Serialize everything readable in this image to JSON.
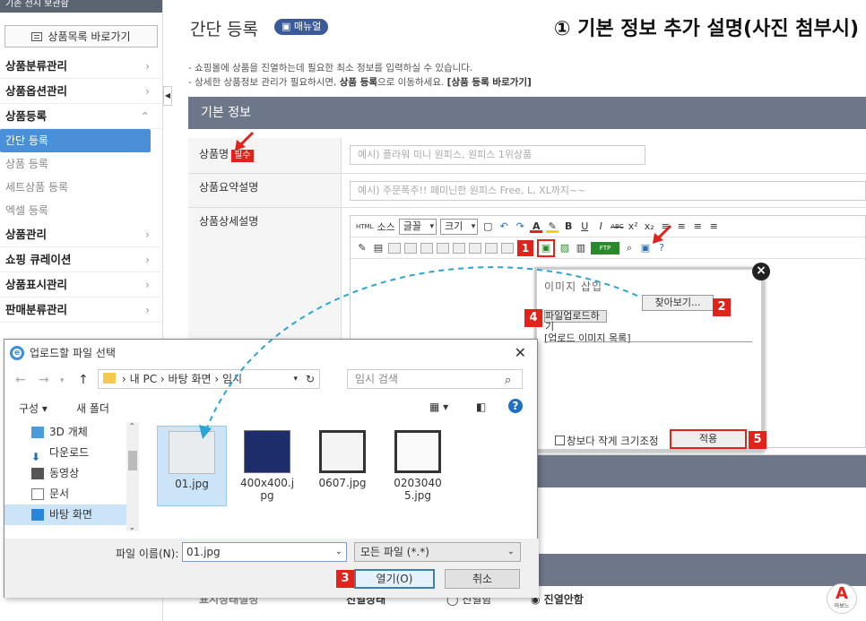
{
  "sidebar": {
    "top_text": "기존 전시 보관함",
    "shortcut_button": "상품목록 바로가기",
    "menu": [
      {
        "label": "상품분류관리",
        "type": "item"
      },
      {
        "label": "상품옵션관리",
        "type": "item"
      },
      {
        "label": "상품등록",
        "type": "item",
        "expanded": true
      },
      {
        "label": "간단 등록",
        "type": "sub",
        "active": true
      },
      {
        "label": "상품 등록",
        "type": "sub"
      },
      {
        "label": "세트상품 등록",
        "type": "sub"
      },
      {
        "label": "엑셀 등록",
        "type": "sub"
      },
      {
        "label": "상품관리",
        "type": "item"
      },
      {
        "label": "쇼핑 큐레이션",
        "type": "item"
      },
      {
        "label": "상품표시관리",
        "type": "item"
      },
      {
        "label": "판매분류관리",
        "type": "item"
      }
    ]
  },
  "header": {
    "title": "간단 등록",
    "manual_button": "매뉴얼",
    "caption": "① 기본 정보 추가 설명(사진 첨부시)"
  },
  "description": {
    "line1": "- 쇼핑몰에 상품을 진열하는데 필요한 최소 정보를 입력하실 수 있습니다.",
    "line2_a": "- 상세한 상품정보 관리가 필요하시면, ",
    "line2_b": "상품 등록",
    "line2_c": "으로 이동하세요. ",
    "line2_d": "[상품 등록 바로가기]"
  },
  "basic_info": {
    "section_title": "기본 정보",
    "product_name_label": "상품명",
    "required_badge": "필수",
    "product_name_placeholder": "예시) 플라워 미니 원피스, 원피스 1위상품",
    "summary_label": "상품요약설명",
    "summary_placeholder": "예시) 주문폭주!! 페미닌한 원피스 Free, L, XL까지~~",
    "detail_label": "상품상세설명"
  },
  "editor": {
    "source": "소스",
    "font": "글꼴",
    "size": "크기"
  },
  "image_dialog": {
    "title": "이미지 삽입",
    "browse_button": "찾아보기...",
    "upload_button": "파일업로드하기",
    "list_label": "[업로드 이미지 목록]",
    "resize_checkbox": "창보다 작게 크기조정",
    "apply_button": "적용"
  },
  "step_badges": [
    "1",
    "2",
    "3",
    "4",
    "5"
  ],
  "file_dialog": {
    "title": "업로드할 파일 선택",
    "path": [
      "내 PC",
      "바탕 화면",
      "임시"
    ],
    "search_placeholder": "임시 검색",
    "organize": "구성",
    "new_folder": "새 폴더",
    "sidebar": [
      "3D 개체",
      "다운로드",
      "동영상",
      "문서",
      "바탕 화면"
    ],
    "files": [
      "01.jpg",
      "400x400.jpg",
      "0607.jpg",
      "02030405.jpg"
    ],
    "filename_label": "파일 이름(N):",
    "filename_value": "01.jpg",
    "filetype": "모든 파일 (*.*)",
    "open_button": "열기(O)",
    "cancel_button": "취소"
  },
  "bottom_row": {
    "label": "표시상태설정",
    "option_a": "진열함",
    "option_b": "진열안함"
  },
  "logo": {
    "letter": "A",
    "sub": "아보느"
  },
  "colors": {
    "accent": "#e2231a",
    "section": "#6e7789",
    "active": "#4a90d9",
    "dashed": "#2aa3d8"
  }
}
